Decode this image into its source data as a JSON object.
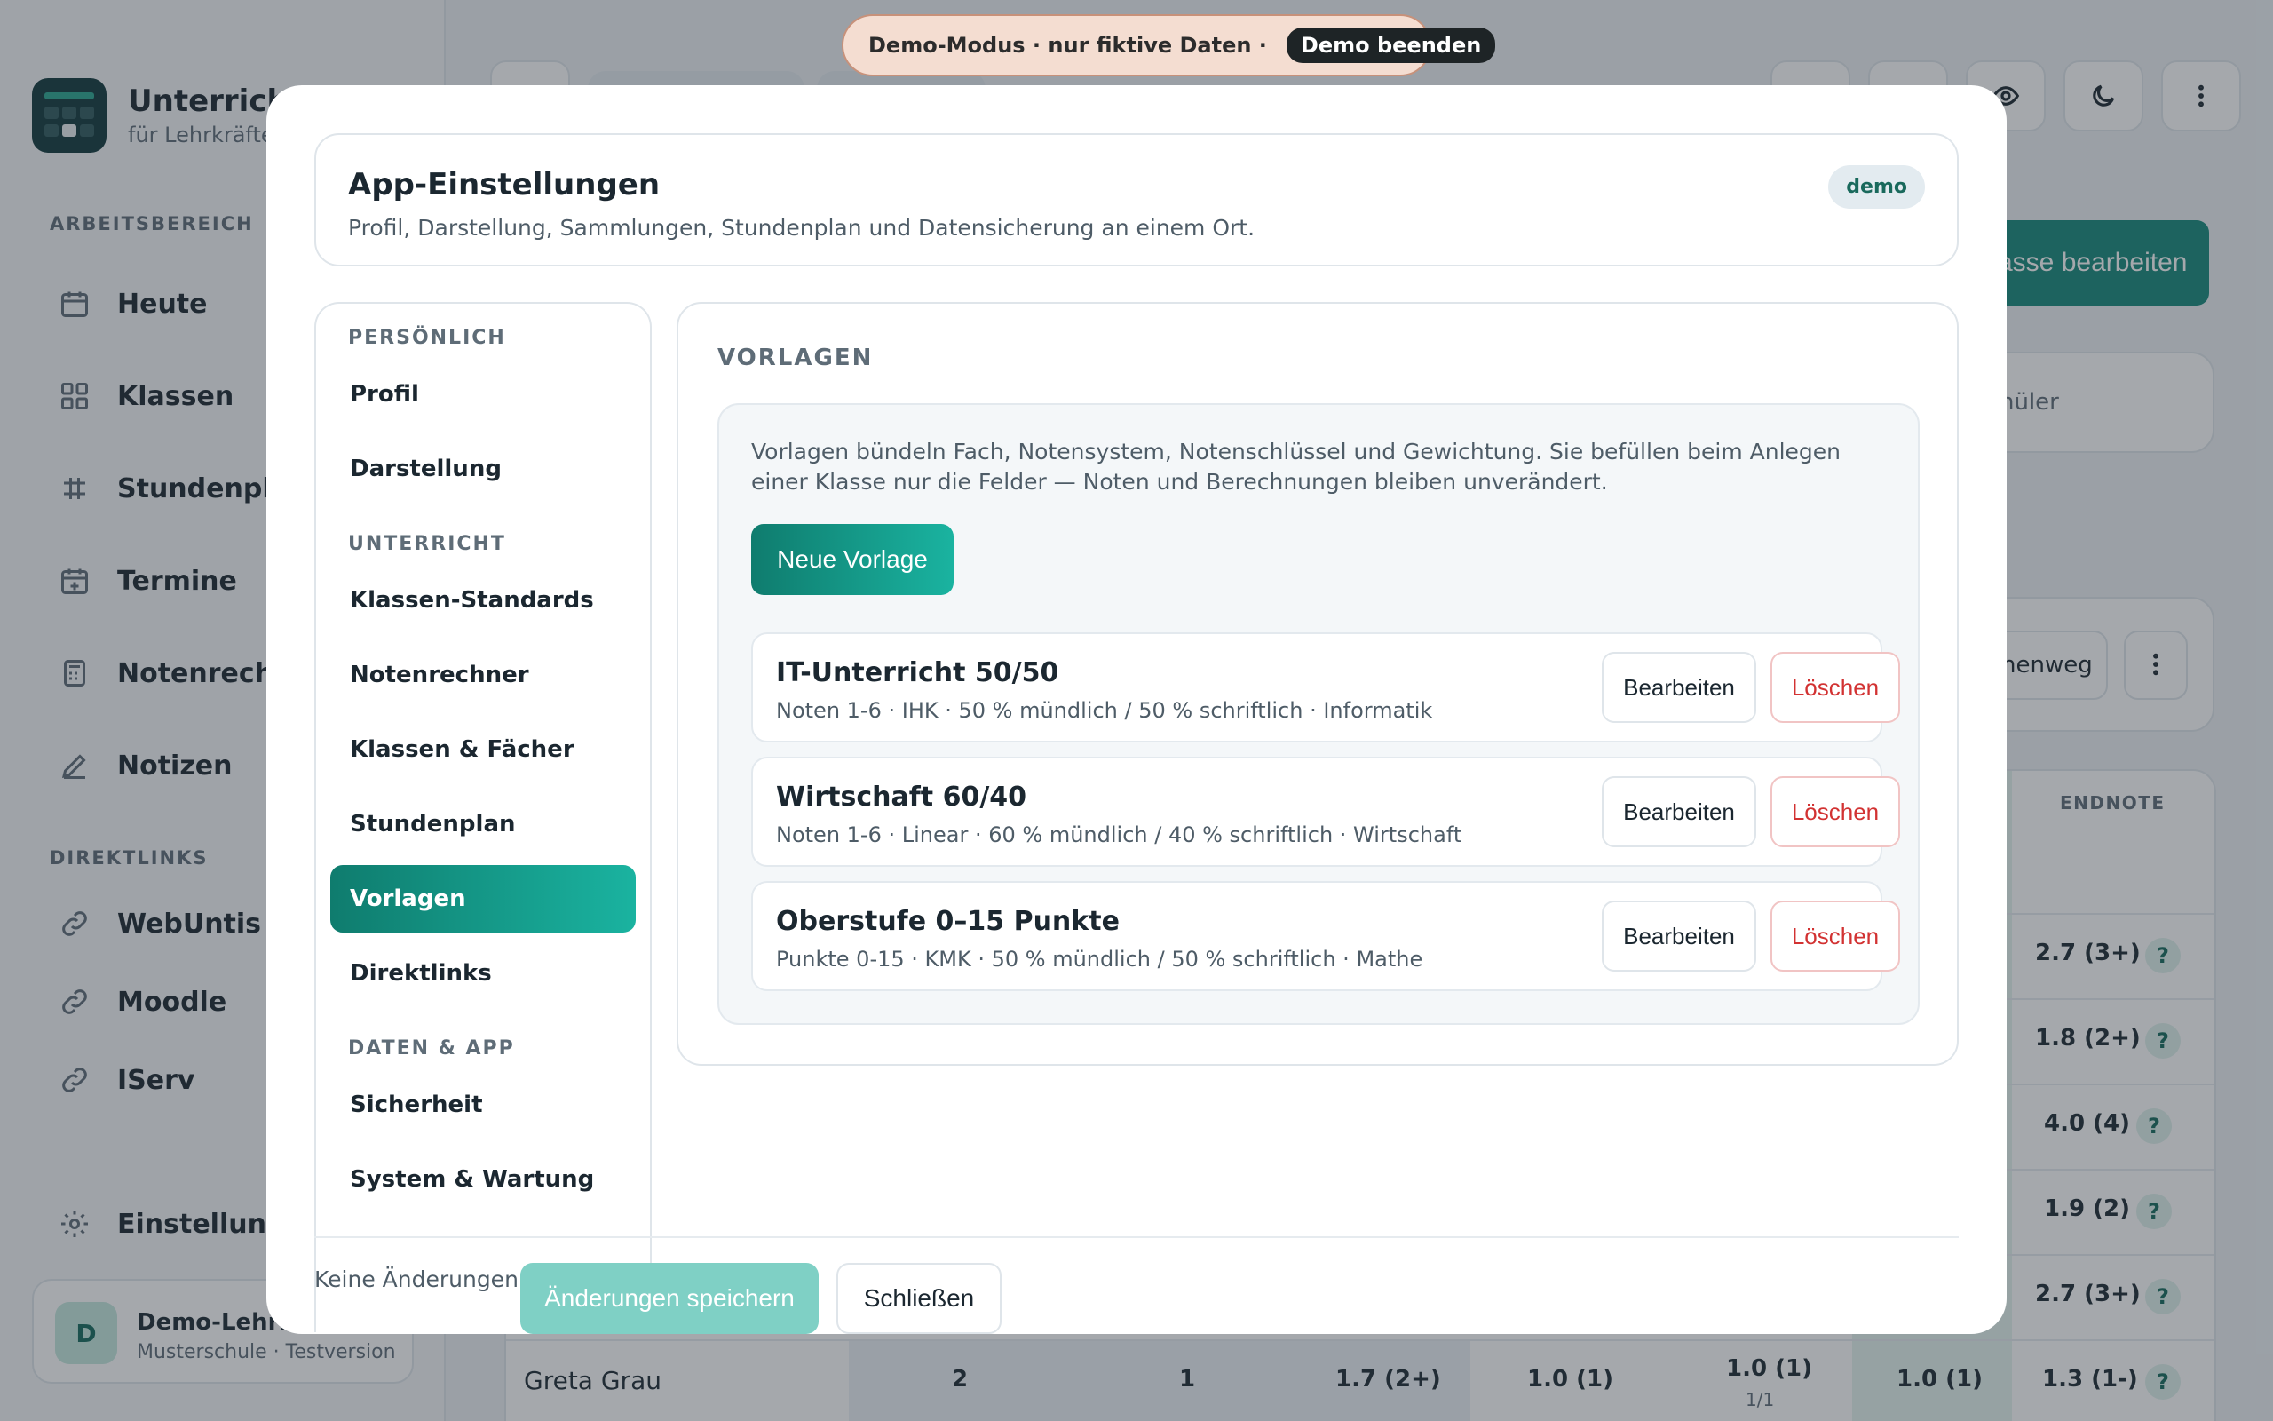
{
  "demo_banner": {
    "text": "Demo-Modus · nur fiktive Daten ·",
    "end_label": "Demo beenden"
  },
  "app": {
    "brand_title": "UnterrichtP",
    "brand_subtitle": "für Lehrkräfte",
    "sections": {
      "workspace": "ARBEITSBEREICH",
      "links": "DIREKTLINKS"
    },
    "nav": [
      "Heute",
      "Klassen",
      "Stundenplan",
      "Termine",
      "Notenrechn",
      "Notizen"
    ],
    "links": [
      "WebUntis",
      "Moodle",
      "IServ"
    ],
    "settings": "Einstellungen",
    "user": {
      "initial": "D",
      "name": "Demo-Lehrkr",
      "meta": "Musterschule · Testversion"
    },
    "edit_class": "asse bearbeiten",
    "students_hint": "hüler",
    "path_btn": "henweg",
    "table": {
      "endnote_header": "ENDNOTE",
      "rows": [
        {
          "end": "2.7 (3+)"
        },
        {
          "end": "1.8 (2+)"
        },
        {
          "end": "4.0 (4)"
        },
        {
          "end": "1.9 (2)"
        },
        {
          "end": "2.7 (3+)"
        },
        {
          "name": "Greta Grau",
          "c1": "2",
          "c2": "1",
          "c3": "1.7 (2+)",
          "c4": "1.0 (1)",
          "c5": "1.0 (1)",
          "c5sub": "1/1",
          "c6": "1.0 (1)",
          "end": "1.3 (1-)"
        }
      ],
      "help": "?"
    }
  },
  "modal": {
    "title": "App-Einstellungen",
    "subtitle": "Profil, Darstellung, Sammlungen, Stundenplan und Datensicherung an einem Ort.",
    "badge": "demo",
    "nav_groups": {
      "personal": "PERSÖNLICH",
      "teaching": "UNTERRICHT",
      "data": "DATEN & APP"
    },
    "nav": {
      "profil": "Profil",
      "darstellung": "Darstellung",
      "klassen_standards": "Klassen-Standards",
      "notenrechner": "Notenrechner",
      "klassen_faecher": "Klassen & Fächer",
      "stundenplan": "Stundenplan",
      "vorlagen": "Vorlagen",
      "direktlinks": "Direktlinks",
      "sicherheit": "Sicherheit",
      "system": "System & Wartung"
    },
    "section_title": "VORLAGEN",
    "description": "Vorlagen bündeln Fach, Notensystem, Notenschlüssel und Gewichtung. Sie befüllen beim Anlegen einer Klasse nur die Felder — Noten und Berechnungen bleiben unverändert.",
    "new_template": "Neue Vorlage",
    "templates": [
      {
        "name": "IT-Unterricht 50/50",
        "meta": "Noten 1-6 · IHK · 50 % mündlich / 50 % schriftlich · Informatik"
      },
      {
        "name": "Wirtschaft 60/40",
        "meta": "Noten 1-6 · Linear · 60 % mündlich / 40 % schriftlich · Wirtschaft"
      },
      {
        "name": "Oberstufe 0–15 Punkte",
        "meta": "Punkte 0-15 · KMK · 50 % mündlich / 50 % schriftlich · Mathe"
      }
    ],
    "edit_label": "Bearbeiten",
    "delete_label": "Löschen",
    "footer": {
      "status": "Keine Änderungen",
      "save": "Änderungen speichern",
      "close": "Schließen"
    }
  }
}
